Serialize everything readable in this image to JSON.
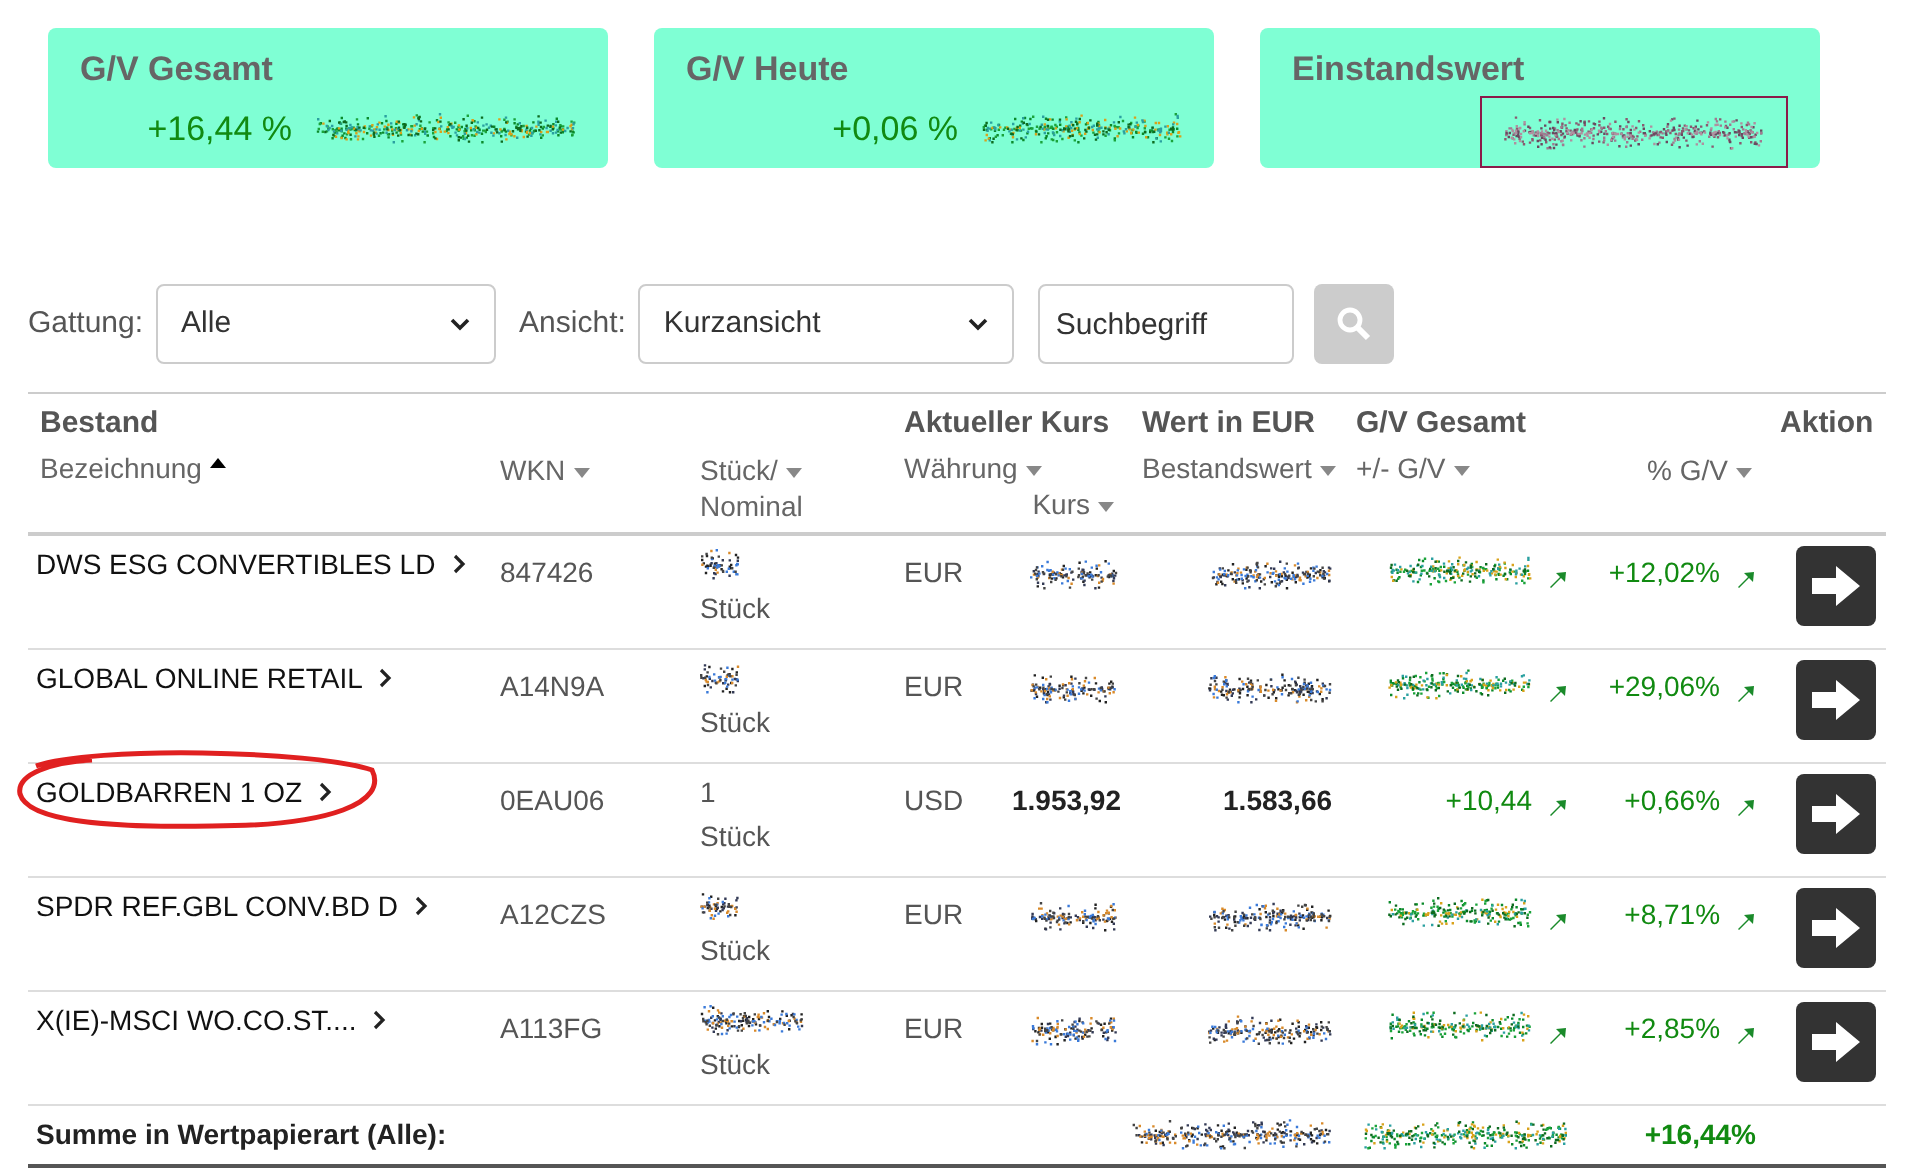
{
  "cards": [
    {
      "title": "G/V Gesamt",
      "kind": "gain",
      "value": "+16,44 %"
    },
    {
      "title": "G/V Heute",
      "kind": "gain",
      "value": "+0,06 %"
    },
    {
      "title": "Einstandswert",
      "kind": "boxed"
    }
  ],
  "filters": [
    {
      "label": "Gattung:",
      "value": "Alle"
    },
    {
      "label": "Ansicht:",
      "value": "Kurzansicht"
    }
  ],
  "search": {
    "placeholder": "Suchbegriff"
  },
  "columns": [
    {
      "lines": [
        {
          "text": "Bestand",
          "kind": "group"
        },
        {
          "text": "Bezeichnung",
          "kind": "sortable",
          "sorted": true
        }
      ]
    },
    {
      "lines": [
        {
          "text": "WKN",
          "kind": "sortable",
          "sorted": false
        }
      ]
    },
    {
      "lines": [
        {
          "text": "Stück/",
          "kind": "sortable",
          "sorted": false
        },
        {
          "text": "Nominal",
          "kind": "plain"
        }
      ]
    },
    {
      "lines": [
        {
          "text": "Aktueller Kurs",
          "kind": "group"
        },
        {
          "text": "Währung",
          "kind": "sortable",
          "sorted": false
        },
        {
          "text": "Kurs",
          "kind": "sortable",
          "sorted": false
        }
      ]
    },
    {
      "lines": [
        {
          "text": "Wert in EUR",
          "kind": "group"
        },
        {
          "text": "Bestandswert",
          "kind": "sortable",
          "sorted": false
        }
      ]
    },
    {
      "lines": [
        {
          "text": "G/V Gesamt",
          "kind": "group"
        },
        {
          "text": "+/- G/V",
          "kind": "sortable",
          "sorted": false
        }
      ]
    },
    {
      "lines": [
        {
          "text": "% G/V",
          "kind": "sortable",
          "sorted": false
        }
      ]
    },
    {
      "lines": [
        {
          "text": "Aktion",
          "kind": "group"
        }
      ]
    }
  ],
  "rows": [
    {
      "name": "DWS ESG CONVERTIBLES LD",
      "wkn": "847426",
      "quantity": {
        "kind": "redacted"
      },
      "unit": "Stück",
      "currency": "EUR",
      "price": {
        "kind": "redacted"
      },
      "value": {
        "kind": "redacted"
      },
      "gain": {
        "kind": "redacted",
        "rising": true
      },
      "gain_pct": {
        "text": "+12,02%",
        "rising": true
      },
      "circled": false
    },
    {
      "name": "GLOBAL ONLINE RETAIL",
      "wkn": "A14N9A",
      "quantity": {
        "kind": "redacted"
      },
      "unit": "Stück",
      "currency": "EUR",
      "price": {
        "kind": "redacted"
      },
      "value": {
        "kind": "redacted"
      },
      "gain": {
        "kind": "redacted",
        "rising": true
      },
      "gain_pct": {
        "text": "+29,06%",
        "rising": true
      },
      "circled": false
    },
    {
      "name": "GOLDBARREN 1 OZ",
      "wkn": "0EAU06",
      "quantity": {
        "kind": "text",
        "text": "1"
      },
      "unit": "Stück",
      "currency": "USD",
      "price": {
        "kind": "text",
        "text": "1.953,92"
      },
      "value": {
        "kind": "text",
        "text": "1.583,66"
      },
      "gain": {
        "kind": "text",
        "text": "+10,44",
        "rising": true
      },
      "gain_pct": {
        "text": "+0,66%",
        "rising": true
      },
      "circled": true
    },
    {
      "name": "SPDR REF.GBL CONV.BD D",
      "wkn": "A12CZS",
      "quantity": {
        "kind": "redacted"
      },
      "unit": "Stück",
      "currency": "EUR",
      "price": {
        "kind": "redacted"
      },
      "value": {
        "kind": "redacted"
      },
      "gain": {
        "kind": "redacted",
        "rising": true
      },
      "gain_pct": {
        "text": "+8,71%",
        "rising": true
      },
      "circled": false
    },
    {
      "name": "X(IE)-MSCI WO.CO.ST....",
      "wkn": "A113FG",
      "quantity": {
        "kind": "redacted"
      },
      "unit": "Stück",
      "currency": "EUR",
      "price": {
        "kind": "redacted"
      },
      "value": {
        "kind": "redacted"
      },
      "gain": {
        "kind": "redacted",
        "rising": true
      },
      "gain_pct": {
        "text": "+2,85%",
        "rising": true
      },
      "circled": false
    }
  ],
  "summary": {
    "label": "Summe in Wertpapierart (Alle):",
    "value": {
      "kind": "redacted"
    },
    "gain": {
      "kind": "redacted"
    },
    "gain_pct": "+16,44%"
  }
}
